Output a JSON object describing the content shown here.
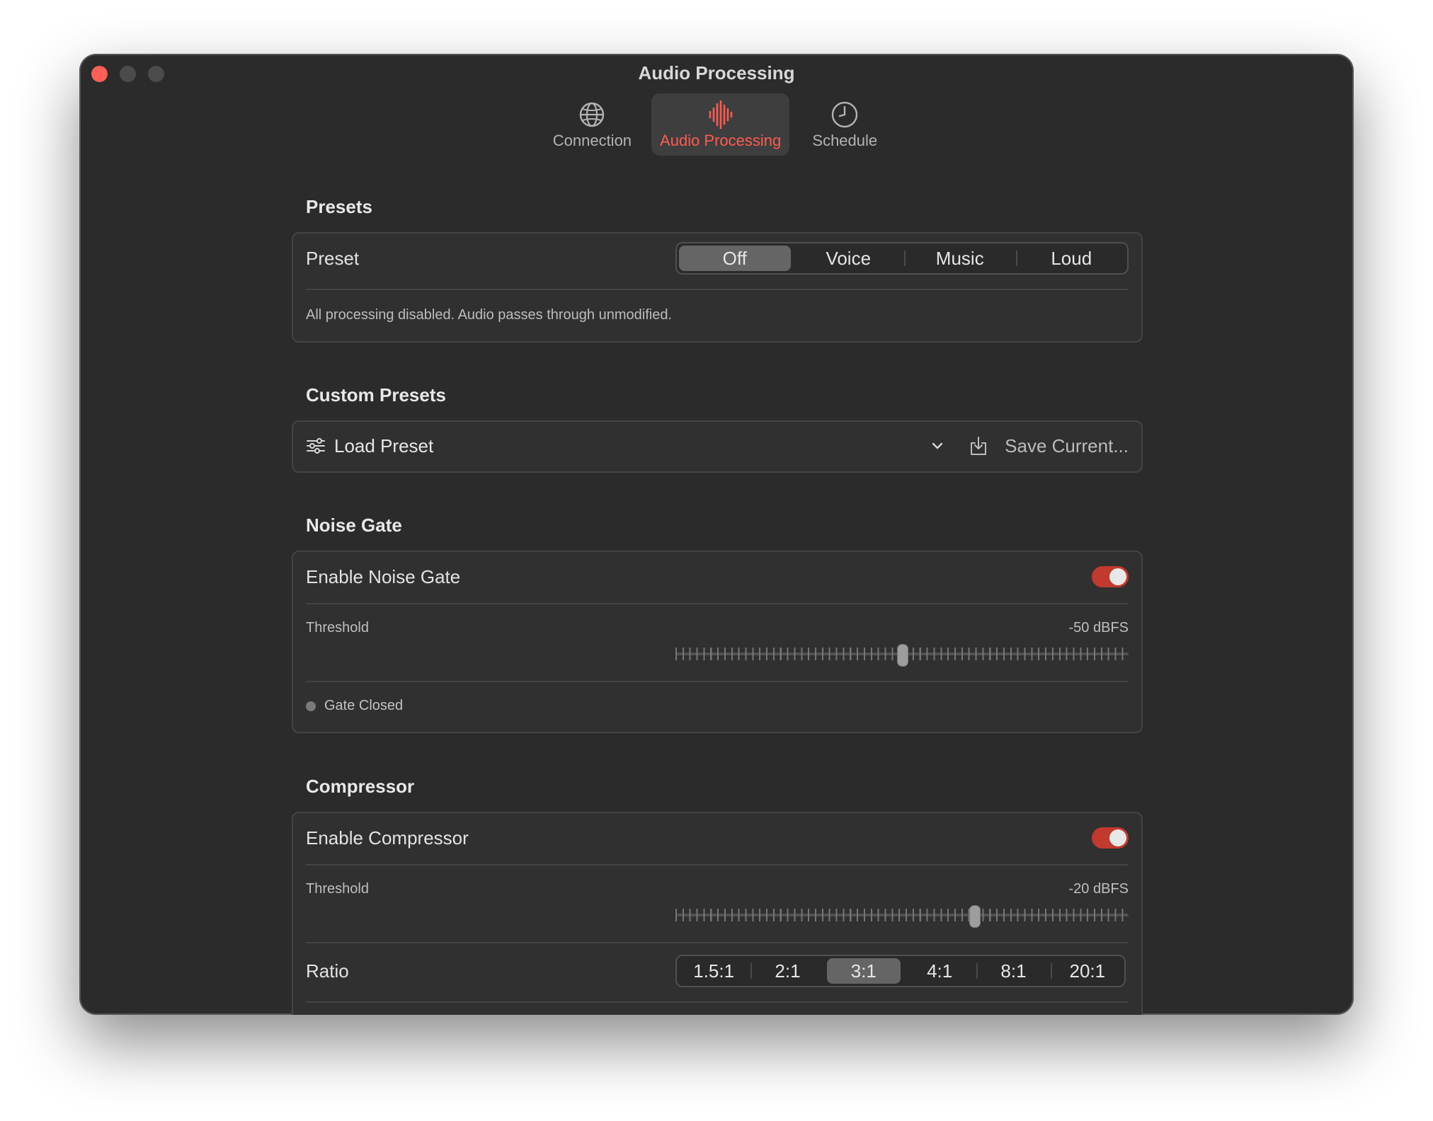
{
  "window": {
    "title": "Audio Processing"
  },
  "toolbar": {
    "items": [
      {
        "label": "Connection",
        "icon": "globe-icon",
        "active": false
      },
      {
        "label": "Audio Processing",
        "icon": "waveform-icon",
        "active": true
      },
      {
        "label": "Schedule",
        "icon": "clock-icon",
        "active": false
      }
    ]
  },
  "presets": {
    "section_title": "Presets",
    "row_label": "Preset",
    "options": [
      "Off",
      "Voice",
      "Music",
      "Loud"
    ],
    "selected": "Off",
    "description": "All processing disabled. Audio passes through unmodified."
  },
  "custom_presets": {
    "section_title": "Custom Presets",
    "load_label": "Load Preset",
    "save_label": "Save Current..."
  },
  "noise_gate": {
    "section_title": "Noise Gate",
    "enable_label": "Enable Noise Gate",
    "enabled": true,
    "threshold_label": "Threshold",
    "threshold_value": "-50 dBFS",
    "threshold_fraction": 0.5,
    "status": "Gate Closed"
  },
  "compressor": {
    "section_title": "Compressor",
    "enable_label": "Enable Compressor",
    "enabled": true,
    "threshold_label": "Threshold",
    "threshold_value": "-20 dBFS",
    "threshold_fraction": 0.66,
    "ratio_label": "Ratio",
    "ratio_options": [
      "1.5:1",
      "2:1",
      "3:1",
      "4:1",
      "8:1",
      "20:1"
    ],
    "ratio_selected": "3:1"
  },
  "colors": {
    "accent": "#ff5c50",
    "toggle_on": "#c2392e",
    "window_bg": "#2b2b2b",
    "card_bg": "#303030"
  }
}
